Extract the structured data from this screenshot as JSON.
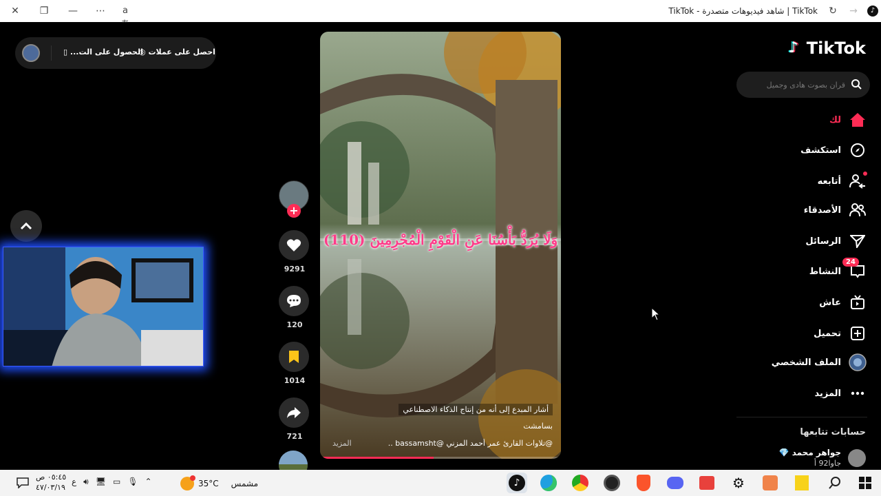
{
  "window": {
    "title": "TikTok | شاهد فيديوهات متصدرة - TikTok"
  },
  "topbar": {
    "coins_label": "احصل على عملات",
    "app_label": "الحصول على الت..."
  },
  "logo": {
    "text": "TikTok"
  },
  "search": {
    "placeholder": "قران بصوت هادى وجميل"
  },
  "nav": [
    {
      "label": "لك",
      "icon": "home-icon",
      "active": true
    },
    {
      "label": "استكشف",
      "icon": "compass-icon"
    },
    {
      "label": "أتابعه",
      "icon": "following-icon"
    },
    {
      "label": "الأصدقاء",
      "icon": "friends-icon"
    },
    {
      "label": "الرسائل",
      "icon": "messages-icon"
    },
    {
      "label": "النشاط",
      "icon": "activity-icon",
      "badge": "24"
    },
    {
      "label": "عاش",
      "icon": "live-icon"
    },
    {
      "label": "تحميل",
      "icon": "upload-icon"
    },
    {
      "label": "الملف الشخصي",
      "icon": "profile-icon"
    },
    {
      "label": "المزيد",
      "icon": "more-icon"
    }
  ],
  "following": {
    "title": "حسابات تتابعها",
    "accounts": [
      {
        "name": "جواهر محمد 💎",
        "username": "جاوا92 أ"
      }
    ]
  },
  "video": {
    "verse": "وَلَا يُرَدُّ بَأْسُنَا عَنِ الْقَوْمِ الْمُجْرِمِينَ (110)",
    "ai_note": "أشار المبدع إلى أنه من إنتاج الذكاء الاصطناعي",
    "author": "بسامشت",
    "caption": "@تلاوات القارئ عمر أحمد المزني @bassamsht ...",
    "more": "المزيد",
    "progress": 0.47
  },
  "actions": {
    "likes": "9291",
    "comments": "120",
    "saves": "1014",
    "shares": "721"
  },
  "taskbar": {
    "time": "٠٥:٤٥ ص",
    "date": "٤٧/٠٣/١٩",
    "lang": "ع",
    "weather_temp": "35°C",
    "weather_label": "مشمس"
  },
  "colors": {
    "accent": "#fe2c55",
    "background": "#000000",
    "verse": "#fe3c8a"
  }
}
